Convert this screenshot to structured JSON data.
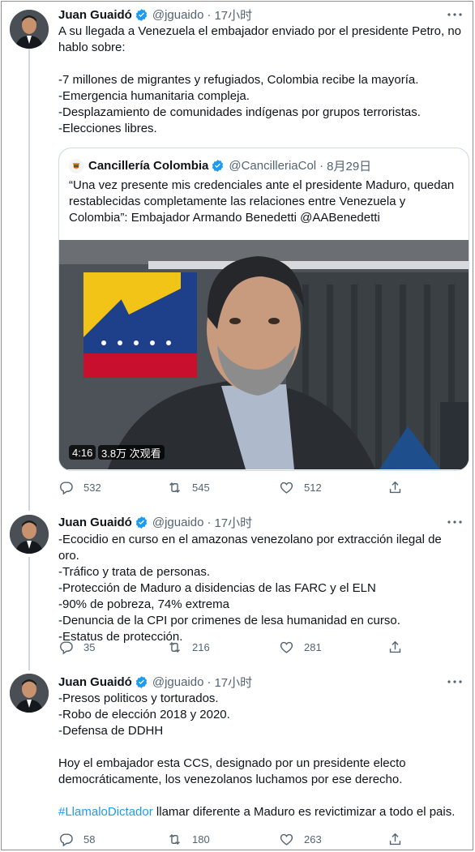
{
  "author": {
    "name": "Juan Guaidó",
    "handle": "@jguaido",
    "separator": "·"
  },
  "tweets": [
    {
      "time": "17小时",
      "text": "A su llegada a Venezuela el embajador enviado por el presidente Petro, no hablo sobre:\n\n-7 millones de migrantes y refugiados, Colombia recibe la mayoría.\n-Emergencia humanitaria compleja.\n-Desplazamiento de comunidades indígenas por grupos terroristas.\n-Elecciones libres.",
      "quote": {
        "name": "Cancillería Colombia",
        "handle": "@CancilleriaCol",
        "separator": "·",
        "time": "8月29日",
        "text": "“Una vez presente mis credenciales ante el presidente Maduro, quedan restablecidas completamente las relaciones entre Venezuela y Colombia”: Embajador Armando Benedetti @AABenedetti",
        "video": {
          "duration": "4:16",
          "views": "3.8万 次观看"
        }
      },
      "replies": "532",
      "retweets": "545",
      "likes": "512"
    },
    {
      "time": "17小时",
      "text": "-Ecocidio en curso en el amazonas venezolano por extracción ilegal de oro.\n-Tráfico y trata de personas.\n-Protección de Maduro a disidencias de las FARC y el ELN\n-90% de pobreza, 74% extrema\n-Denuncia de la CPI por crimenes de lesa humanidad en curso.\n-Estatus de protección.",
      "replies": "35",
      "retweets": "216",
      "likes": "281"
    },
    {
      "time": "17小时",
      "text": "-Presos politicos y torturados.\n-Robo de elección 2018 y 2020.\n-Defensa de DDHH\n\nHoy el embajador esta CCS, designado por un presidente electo democráticamente, los venezolanos luchamos por ese derecho.\n\n",
      "hashtag": "#LlamaloDictador",
      "text_after_hashtag": " llamar diferente a Maduro es revictimizar a todo el pais.",
      "replies": "58",
      "retweets": "180",
      "likes": "263"
    }
  ],
  "colors": {
    "accent": "#1d9bf0",
    "secondary_text": "#536471",
    "border": "#cfd9de"
  },
  "icons": [
    "verified-badge-icon",
    "more-icon",
    "reply-icon",
    "retweet-icon",
    "like-icon",
    "share-icon"
  ]
}
